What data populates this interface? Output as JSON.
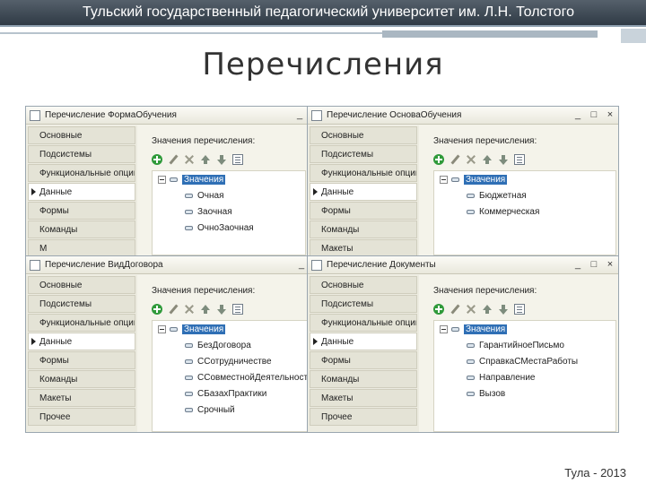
{
  "slide": {
    "header": "Тульский государственный педагогический университет им. Л.Н. Толстого",
    "title": "Перечисления",
    "footer": "Тула - 2013"
  },
  "windows": [
    {
      "title": "Перечисление ФормаОбучения",
      "controls": [
        "_"
      ],
      "nav": [
        "Основные",
        "Подсистемы",
        "Функциональные опции",
        "Данные",
        "Формы",
        "Команды",
        "М"
      ],
      "active": 3,
      "values_label": "Значения перечисления:",
      "root": "Значения",
      "items": [
        "Очная",
        "Заочная",
        "ОчноЗаочная"
      ]
    },
    {
      "title": "Перечисление ОсноваОбучения",
      "controls": [
        "_",
        "□",
        "×"
      ],
      "nav": [
        "Основные",
        "Подсистемы",
        "Функциональные опции",
        "Данные",
        "Формы",
        "Команды",
        "Макеты"
      ],
      "active": 3,
      "values_label": "Значения перечисления:",
      "root": "Значения",
      "items": [
        "Бюджетная",
        "Коммерческая"
      ]
    },
    {
      "title": "Перечисление ВидДоговора",
      "controls": [
        "_"
      ],
      "nav": [
        "Основные",
        "Подсистемы",
        "Функциональные опции",
        "Данные",
        "Формы",
        "Команды",
        "Макеты",
        "Прочее"
      ],
      "active": 3,
      "values_label": "Значения перечисления:",
      "root": "Значения",
      "items": [
        "БезДоговора",
        "ССотрудничестве",
        "ССовместнойДеятельности",
        "СБазахПрактики",
        "Срочный"
      ]
    },
    {
      "title": "Перечисление Документы",
      "controls": [
        "_",
        "□",
        "×"
      ],
      "nav": [
        "Основные",
        "Подсистемы",
        "Функциональные опции",
        "Данные",
        "Формы",
        "Команды",
        "Макеты",
        "Прочее"
      ],
      "active": 3,
      "values_label": "Значения перечисления:",
      "root": "Значения",
      "items": [
        "ГарантийноеПисьмо",
        "СправкаСМестаРаботы",
        "Направление",
        "Вызов"
      ]
    }
  ]
}
